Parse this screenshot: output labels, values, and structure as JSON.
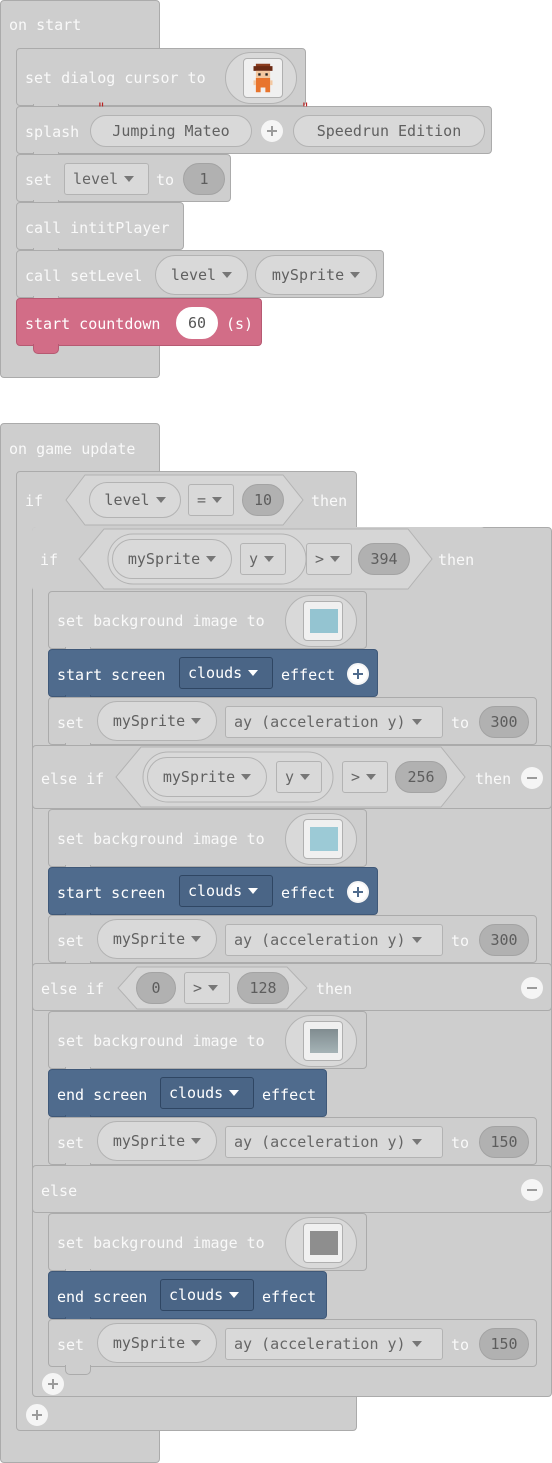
{
  "on_start": {
    "hat_label": "on start",
    "set_dialog_cursor": {
      "label": "set dialog cursor to",
      "image_icon": "character-sprite-icon"
    },
    "splash": {
      "label": "splash",
      "title": "Jumping Mateo",
      "subtitle": "Speedrun Edition",
      "quote_marks": [
        "\"",
        "\""
      ]
    },
    "set_level": {
      "label_set": "set",
      "variable": "level",
      "label_to": "to",
      "value": "1"
    },
    "call_init": {
      "label": "call intitPlayer"
    },
    "call_set_level": {
      "label": "call setLevel",
      "arg1": "level",
      "arg2": "mySprite"
    },
    "countdown": {
      "label": "start countdown",
      "value": "60",
      "unit": "(s)"
    }
  },
  "on_game_update": {
    "hat_label": "on game update",
    "outer_if": {
      "if_label": "if",
      "then_label": "then",
      "left": "level",
      "op": "=",
      "right": "10"
    },
    "inner_if": {
      "if_label": "if",
      "then_label": "then",
      "else_if_label": "else if",
      "else_label": "else",
      "branches": [
        {
          "cond": {
            "sprite": "mySprite",
            "prop": "y",
            "op": ">",
            "value": "394"
          },
          "bg_label": "set background image to",
          "bg_color": "#94c4d1",
          "effect": {
            "label_start": "start screen",
            "effect": "clouds",
            "label_end": "effect"
          },
          "set": {
            "label_set": "set",
            "sprite": "mySprite",
            "prop": "ay (acceleration y)",
            "label_to": "to",
            "value": "300"
          }
        },
        {
          "cond": {
            "sprite": "mySprite",
            "prop": "y",
            "op": ">",
            "value": "256"
          },
          "bg_label": "set background image to",
          "bg_color": "#9ccad6",
          "effect": {
            "label_start": "start screen",
            "effect": "clouds",
            "label_end": "effect"
          },
          "set": {
            "label_set": "set",
            "sprite": "mySprite",
            "prop": "ay (acceleration y)",
            "label_to": "to",
            "value": "300"
          }
        },
        {
          "cond": {
            "left": "0",
            "op": ">",
            "right": "128"
          },
          "bg_label": "set background image to",
          "bg_color": "#8a9a9e",
          "effect": {
            "label_start": "end screen",
            "effect": "clouds",
            "label_end": "effect"
          },
          "set": {
            "label_set": "set",
            "sprite": "mySprite",
            "prop": "ay (acceleration y)",
            "label_to": "to",
            "value": "150"
          }
        },
        {
          "bg_label": "set background image to",
          "bg_color": "#8e8e8e",
          "effect": {
            "label_start": "end screen",
            "effect": "clouds",
            "label_end": "effect"
          },
          "set": {
            "label_set": "set",
            "sprite": "mySprite",
            "prop": "ay (acceleration y)",
            "label_to": "to",
            "value": "150"
          }
        }
      ]
    }
  },
  "colors": {
    "block_gray": "#cecece",
    "countdown_pink": "#d26d87",
    "scene_blue": "#4f6b8d"
  }
}
